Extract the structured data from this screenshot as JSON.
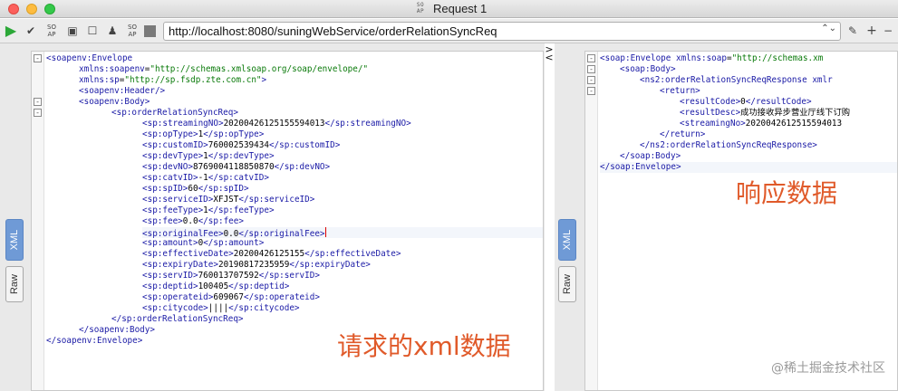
{
  "window": {
    "title": "Request 1",
    "soap_badge": "SO AP"
  },
  "toolbar": {
    "run_icon": "▶",
    "endpoint_url": "http://localhost:8080/suningWebService/orderRelationSyncReq",
    "stepper": "⌃⌄",
    "icons": [
      "run-icon",
      "check-icon",
      "cancel-icon",
      "maximize-icon",
      "stop-icon",
      "user-icon",
      "settings-icon",
      "square-icon"
    ]
  },
  "request_pane": {
    "tabs": {
      "xml": "XML",
      "raw": "Raw"
    },
    "lines": [
      {
        "fold": "-",
        "html": "<span class=\"t\">&lt;soapenv:Envelope</span>"
      },
      {
        "fold": "",
        "html": "      <span class=\"a\">xmlns:soapenv</span>=<span class=\"v\">\"http://schemas.xmlsoap.org/soap/envelope/\"</span>"
      },
      {
        "fold": "",
        "html": "      <span class=\"a\">xmlns:sp</span>=<span class=\"v\">\"http://sp.fsdp.zte.com.cn\"</span><span class=\"t\">&gt;</span>"
      },
      {
        "fold": "",
        "html": "      <span class=\"t\">&lt;soapenv:Header/&gt;</span>"
      },
      {
        "fold": "-",
        "html": "      <span class=\"t\">&lt;soapenv:Body&gt;</span>"
      },
      {
        "fold": "-",
        "html": "         <span class=\"t\">&lt;sp:orderRelationSyncReq&gt;</span>"
      }
    ]
  },
  "request_xml": {
    "root_open": "<soapenv:Envelope",
    "ns_soapenv": "xmlns:soapenv=\"http://schemas.xmlsoap.org/soap/envelope/\"",
    "ns_sp": "xmlns:sp=\"http://sp.fsdp.zte.com.cn\">",
    "header": "<soapenv:Header/>",
    "body_open": "<soapenv:Body>",
    "req_open": "<sp:orderRelationSyncReq>",
    "fields": [
      {
        "tag": "sp:streamingNO",
        "value": "20200426125155594013"
      },
      {
        "tag": "sp:opType",
        "value": "1"
      },
      {
        "tag": "sp:customID",
        "value": "760002539434"
      },
      {
        "tag": "sp:devType",
        "value": "1"
      },
      {
        "tag": "sp:devNO",
        "value": "8769004118850870"
      },
      {
        "tag": "sp:catvID",
        "value": "-1"
      },
      {
        "tag": "sp:spID",
        "value": "60"
      },
      {
        "tag": "sp:serviceID",
        "value": "XFJST"
      },
      {
        "tag": "sp:feeType",
        "value": "1"
      },
      {
        "tag": "sp:fee",
        "value": "0.0"
      },
      {
        "tag": "sp:originalFee",
        "value": "0.0"
      },
      {
        "tag": "sp:amount",
        "value": "0"
      },
      {
        "tag": "sp:effectiveDate",
        "value": "20200426125155"
      },
      {
        "tag": "sp:expiryDate",
        "value": "20190817235959"
      },
      {
        "tag": "sp:servID",
        "value": "760013707592"
      },
      {
        "tag": "sp:deptid",
        "value": "100405"
      },
      {
        "tag": "sp:operateid",
        "value": "609067"
      },
      {
        "tag": "sp:citycode",
        "value": "||||"
      }
    ],
    "req_close": "</sp:orderRelationSyncReq>",
    "body_close": "</soapenv:Body>",
    "root_close": "</soapenv:Envelope>"
  },
  "response_xml": {
    "root_open": "<soap:Envelope",
    "ns_soap": "xmlns:soap=\"http://schemas.xm",
    "body_open": "<soap:Body>",
    "resp_open": "<ns2:orderRelationSyncReqResponse",
    "resp_ns": "xmlr",
    "return_open": "<return>",
    "fields": [
      {
        "tag": "resultCode",
        "value": "0",
        "close": "</resultCode>"
      },
      {
        "tag": "resultDesc",
        "value": "成功接收异步营业厅线下订购",
        "close": ""
      },
      {
        "tag": "streamingNo",
        "value": "2020042612515594013",
        "close": ""
      }
    ],
    "return_close": "</return>",
    "resp_close": "</ns2:orderRelationSyncReqResponse>",
    "body_close": "</soap:Body>",
    "root_close": "</soap:Envelope>"
  },
  "response_pane": {
    "tabs": {
      "xml": "XML",
      "raw": "Raw"
    }
  },
  "annotations": {
    "response_label": "响应数据",
    "request_label": "请求的xml数据"
  },
  "watermark": "@稀土掘金技术社区",
  "colors": {
    "tag": "#1a1aa6",
    "attr_value": "#0a7a0a",
    "annotation": "#e05a2a",
    "active_tab": "#6f9ad6"
  }
}
